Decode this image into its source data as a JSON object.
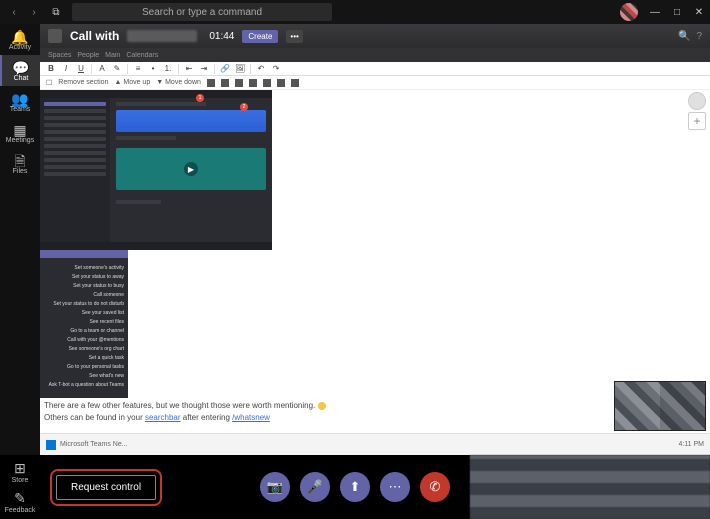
{
  "titlebar": {
    "search_placeholder": "Search or type a command",
    "back_icon": "‹",
    "fwd_icon": "›",
    "popout_icon": "⧉",
    "min_icon": "—",
    "max_icon": "□",
    "close_icon": "✕"
  },
  "leftrail": {
    "items": [
      {
        "label": "Activity",
        "glyph": "🔔"
      },
      {
        "label": "Chat",
        "glyph": "💬"
      },
      {
        "label": "Teams",
        "glyph": "👥"
      },
      {
        "label": "Meetings",
        "glyph": "▦"
      },
      {
        "label": "Files",
        "glyph": "🗎"
      }
    ],
    "bottom": [
      {
        "label": "Store",
        "glyph": "⊞"
      },
      {
        "label": "Feedback",
        "glyph": "✎"
      }
    ]
  },
  "callheader": {
    "title": "Call with",
    "timer": "01:44",
    "nav_tabs": [
      "Spaces",
      "People",
      "Main",
      "Calendars"
    ],
    "create_label": "Create",
    "more_label": "•••"
  },
  "toolbar2": {
    "remove_label": "Remove section",
    "moveup_label": "▲ Move up",
    "movedown_label": "▼ Move down"
  },
  "thumb": {
    "badge1": "1",
    "badge2": "2"
  },
  "cmdpanel": {
    "rows": [
      "Set someone's activity",
      "Set your status to away",
      "Set your status to busy",
      "Call someone",
      "Set your status to do not disturb",
      "See your saved list",
      "See recent files",
      "Go to a team or channel",
      "Call with your @mentions",
      "See someone's org chart",
      "Set a quick task",
      "Go to your personal tasks",
      "See what's new",
      "Ask T-bot a question about Teams"
    ]
  },
  "doc": {
    "line1_a": "There are a few other features, but we thought those were worth mentioning.",
    "line2_a": "Others can be found in your ",
    "line2_link1": "searchbar",
    "line2_b": " after entering ",
    "line2_link2": "/whatsnew"
  },
  "footer": {
    "crumb": "Microsoft Teams Ne...",
    "time": "4:11 PM"
  },
  "participants": {
    "add_icon": "+"
  },
  "callbar": {
    "request_label": "Request control",
    "camera_icon": "📷",
    "mic_icon": "🎤",
    "share_icon": "⬆",
    "more_icon": "⋯",
    "hangup_icon": "✆"
  }
}
